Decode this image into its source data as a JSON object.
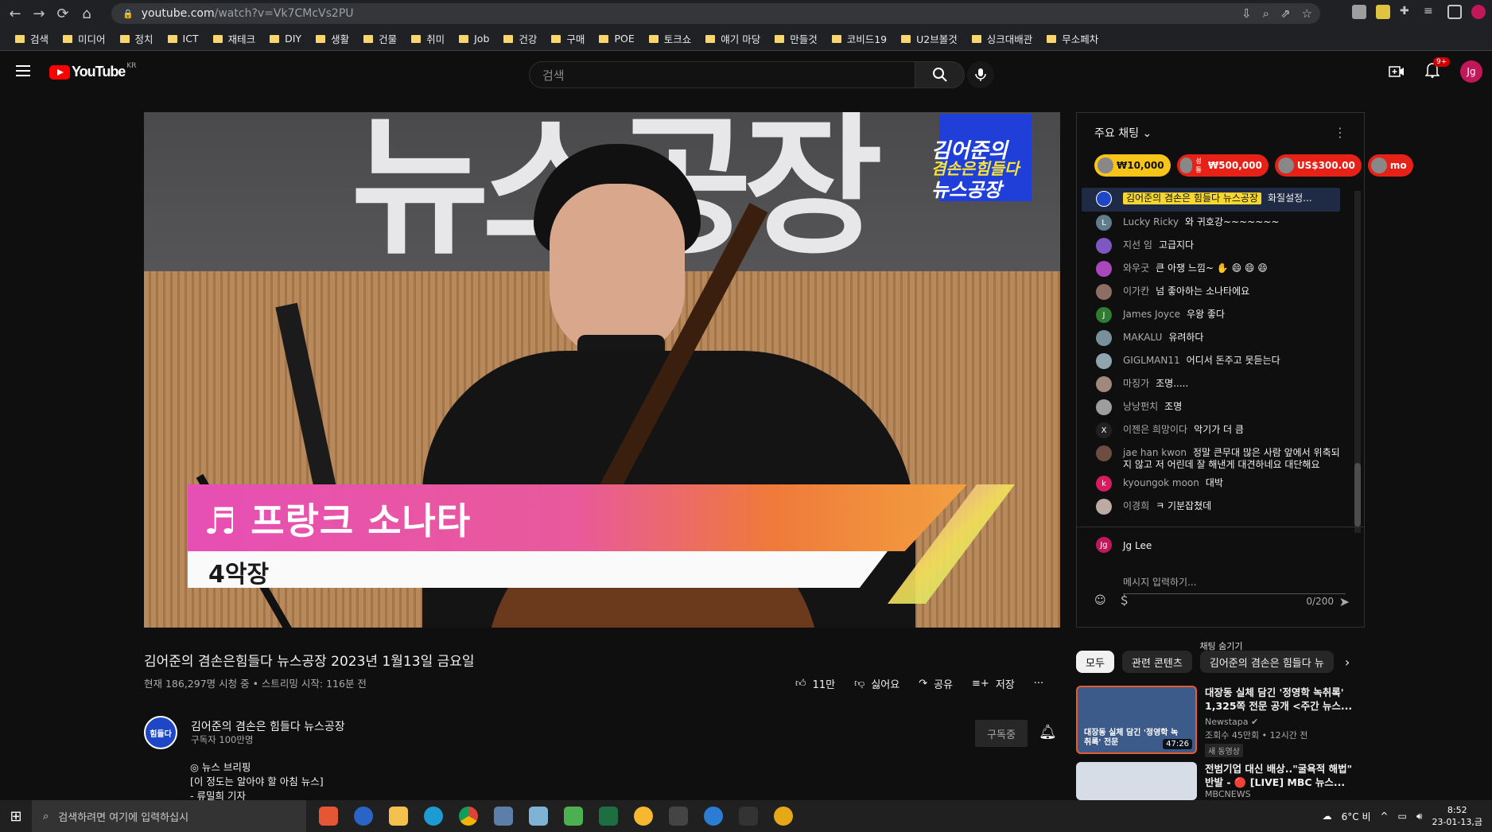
{
  "browser": {
    "url_domain": "youtube.com",
    "url_path": "/watch?v=Vk7CMcVs2PU",
    "bookmarks": [
      "검색",
      "미디어",
      "정치",
      "ICT",
      "재테크",
      "DIY",
      "생활",
      "건물",
      "취미",
      "Job",
      "건강",
      "구매",
      "POE",
      "토크쇼",
      "얘기 마당",
      "만들것",
      "코비드19",
      "U2브볼것",
      "싱크대배관",
      "무소페차"
    ]
  },
  "header": {
    "logo_text": "YouTube",
    "logo_region": "KR",
    "search_placeholder": "검색",
    "notif_count": "9+",
    "avatar_initials": "Jg"
  },
  "video": {
    "song_title": "♬ 프랑크 소나타",
    "movement": "4악장",
    "logo_l1": "김어준의",
    "logo_l2": "겸손은힘들다",
    "logo_l3": "뉴스공장",
    "wall_text": "뉴스공장"
  },
  "chat": {
    "header": "주요 채팅",
    "tickets": [
      {
        "amount": "₩10,000",
        "bg": "#f8c419",
        "fg": "#111"
      },
      {
        "amount": "₩500,000",
        "bg": "#e62117",
        "fg": "#fff",
        "prefix": "성동"
      },
      {
        "amount": "US$300.00",
        "bg": "#e62117",
        "fg": "#fff"
      },
      {
        "amount": "mo",
        "bg": "#e62117",
        "fg": "#fff"
      }
    ],
    "pinned": {
      "author": "김어준의 겸손은 힘들다 뉴스공장",
      "text": "화질설정...",
      "avatar_color": "#1e47c8"
    },
    "messages": [
      {
        "author": "Lucky Ricky",
        "text": "와 귀호강~~~~~~~",
        "avatar": "L",
        "color": "#607d8b"
      },
      {
        "author": "지선 임",
        "text": "고급지다",
        "avatar": "",
        "color": "#7e57c2"
      },
      {
        "author": "와우굿",
        "text": "큰 아쟁 느낌~ ✋ 😄 😄 😄",
        "avatar": "",
        "color": "#ab47bc"
      },
      {
        "author": "이가칸",
        "text": "넘 좋아하는 소나타에요",
        "avatar": "",
        "color": "#8d6e63"
      },
      {
        "author": "James Joyce",
        "text": "우왕 좋다",
        "avatar": "J",
        "color": "#2e7d32"
      },
      {
        "author": "MAKALU",
        "text": "유려하다",
        "avatar": "",
        "color": "#78909c"
      },
      {
        "author": "GIGLMAN11",
        "text": "어디서 돈주고 못듣는다",
        "avatar": "",
        "color": "#90a4ae"
      },
      {
        "author": "마징가",
        "text": "조명.....",
        "avatar": "",
        "color": "#a1887f"
      },
      {
        "author": "낭낭펀치",
        "text": "조명",
        "avatar": "",
        "color": "#9e9e9e"
      },
      {
        "author": "이젠은 희망이다",
        "text": "악기가 더 큼",
        "avatar": "X",
        "color": "#212121"
      },
      {
        "author": "jae han kwon",
        "text": "정말 큰무대 많은 사람 앞에서 위축되지 않고 저 어린데 잘 해낸게 대견하네요 대단해요",
        "avatar": "",
        "color": "#6d4c41"
      },
      {
        "author": "kyoungok moon",
        "text": "대박",
        "avatar": "k",
        "color": "#d81b60"
      },
      {
        "author": "이경희",
        "text": "ㅋ 기분잡쳤데",
        "avatar": "",
        "color": "#bcaaa4"
      }
    ],
    "me_name": "Jg Lee",
    "me_initials": "Jg",
    "input_placeholder": "메시지 입력하기...",
    "counter": "0/200",
    "hide_label": "채팅 숨기기"
  },
  "video_info": {
    "title": "김어준의 겸손은힘들다 뉴스공장 2023년 1월13일 금요일",
    "views": "현재 186,297명 시청 중 • 스트리밍 시작: 116분 전",
    "likes": "11만",
    "dislike_label": "싫어요",
    "share_label": "공유",
    "save_label": "저장",
    "more_label": "···",
    "channel_name": "김어준의 겸손은 힘들다 뉴스공장",
    "channel_subs": "구독자 100만명",
    "channel_avatar_text": "힘들다",
    "subscribed_label": "구독중",
    "desc_lines": [
      "◎ 뉴스 브리핑",
      "[이 정도는 알아야 할 아침 뉴스]",
      "- 류밀희 기자"
    ]
  },
  "chips": [
    "모두",
    "관련 콘텐츠",
    "김어준의 겸손은 힘들다 뉴"
  ],
  "recommendations": [
    {
      "title": "대장동 실체 담긴 '정영학 녹취록' 1,325쪽 전문 공개 <주간 뉴스...",
      "channel": "Newstapa ✔",
      "meta": "조회수 45만회 • 12시간 전",
      "badge": "새 동영상",
      "duration": "47:26",
      "overlay": "대장동 실체 담긴 '정영학 녹취록' 전문",
      "thumb_color": "#3a5f8f"
    },
    {
      "title": "전범기업 대신 배상..\"굴욕적 해법\" 반발 - 🔴 [LIVE] MBC 뉴스...",
      "channel": "MBCNEWS",
      "meta": "",
      "badge": "",
      "duration": "",
      "overlay": "",
      "thumb_color": "#d7dde6"
    }
  ],
  "taskbar": {
    "search_placeholder": "검색하려면 여기에 입력하십시",
    "weather": "6°C 비",
    "time": "8:52",
    "date": "23-01-13,금"
  }
}
